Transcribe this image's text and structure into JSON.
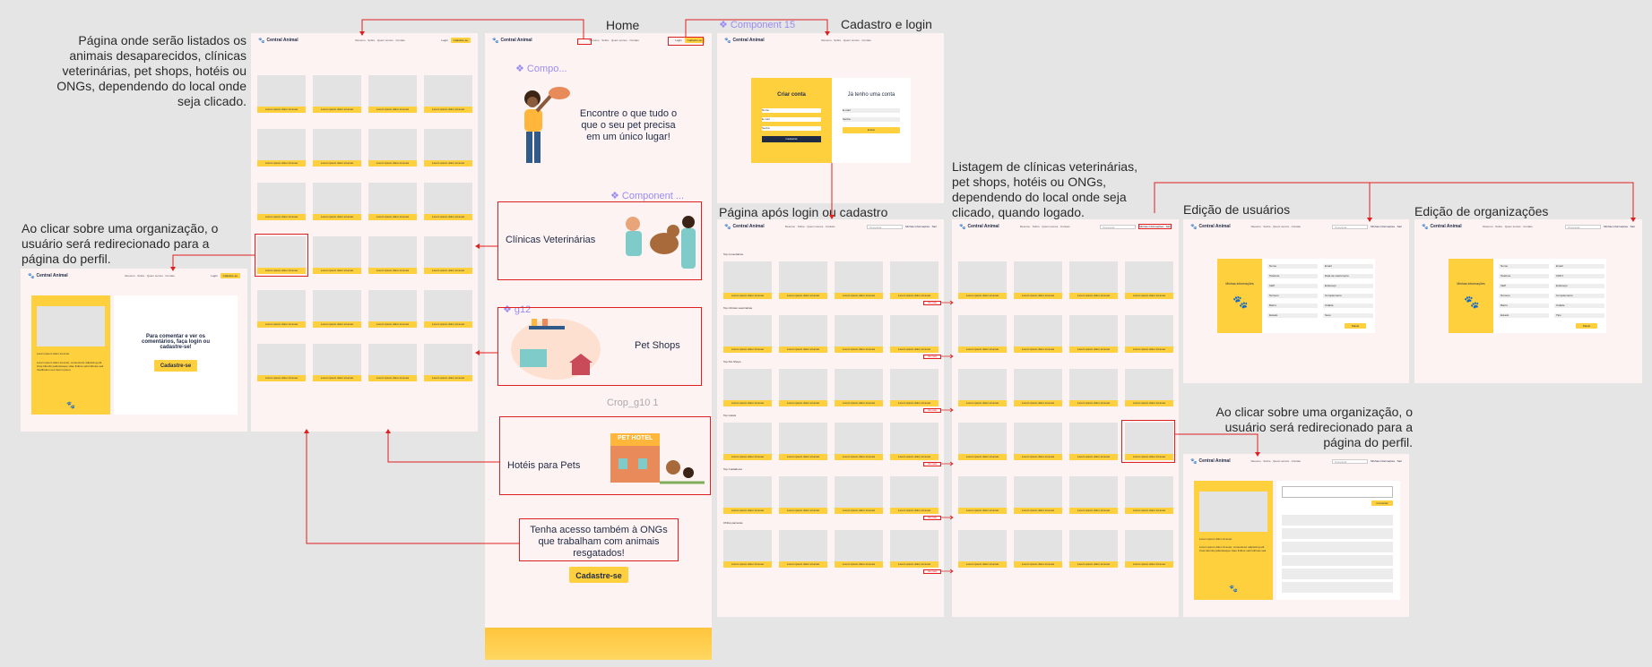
{
  "brand": "Central Animal",
  "card_label": "Lorem ipsum dolor sit amet",
  "nav": {
    "links": "Resumo · Sobre · Quem somos · Contato",
    "login": "Login",
    "signup": "Cadastre-se",
    "search_placeholder": "Pesquisar",
    "profile": "Minhas informações · Sair"
  },
  "annotations": {
    "top_left": "Página onde serão listados os animais desaparecidos, clínicas veterinárias, pet shops, hotéis ou ONGs, dependendo do local onde seja clicado.",
    "org_click_left": "Ao clicar sobre uma organização, o usuário será redirecionado para a página do perfil.",
    "listing_logged": "Listagem de clínicas veterinárias, pet shops, hotéis ou ONGs, dependendo do local onde seja clicado, quando logado.",
    "org_click_right": "Ao clicar sobre uma organização, o usuário será redirecionado para a página do perfil."
  },
  "frame_titles": {
    "home": "Home",
    "cadastro": "Cadastro e login",
    "after_login": "Página após login ou cadastro",
    "user_edit": "Edição de usuários",
    "org_edit": "Edição de organizações"
  },
  "components": {
    "component15": "❖ Component 15",
    "compo": "❖ Compo...",
    "component": "❖ Component ...",
    "g12": "❖ g12",
    "crop": "Crop_g10 1"
  },
  "home": {
    "hero_text": "Encontre o que tudo o que o seu pet precisa em um único lugar!",
    "sections": [
      "Clínicas Veterinárias",
      "Pet Shops",
      "Hotéis para Pets"
    ],
    "ongs_text": "Tenha acesso também à ONGs que trabalham com animais resgatados!",
    "cta": "Cadastre-se",
    "pet_hotel_sign": "PET HOTEL"
  },
  "cadastro": {
    "create_title": "Criar conta",
    "login_title": "Já tenho uma conta",
    "create_fields": [
      "Nome",
      "E-mail",
      "Senha"
    ],
    "create_button": "Cadastrar",
    "login_fields": [
      "E-mail",
      "Senha"
    ],
    "login_button": "Entrar"
  },
  "profile_public": {
    "cta_text": "Para comentar e ver os comentários, faça login ou cadastre-se!",
    "cta_button": "Cadastre-se",
    "org_name": "Lorem ipsum dolor sit amet",
    "org_desc": "Lorem ipsum dolor sit amet, consectetur adipiscing elit. Cras lobortis pellentesque vitae finibus velit ultricies sed. Vestibulum nec lorem ipsum."
  },
  "after_login": {
    "sections": [
      "Top comentários",
      "Top clínicas veterinárias",
      "Top Pet Shops",
      "Top Hotéis",
      "Top Cuidadores",
      "ONGs parceiras"
    ],
    "see_more": "Ver mais"
  },
  "user_edit": {
    "title": "Minhas informações",
    "fields": [
      "Nome",
      "Email",
      "Telefone",
      "Data de nascimento",
      "CEP",
      "Endereço",
      "Número",
      "Complemento",
      "Bairro",
      "Cidade",
      "Estado",
      "Sexo"
    ],
    "save": "Salvar"
  },
  "org_edit": {
    "title": "Minhas informações",
    "fields": [
      "Nome",
      "Email",
      "Telefone",
      "CNPJ",
      "CEP",
      "Endereço",
      "Número",
      "Complemento",
      "Bairro",
      "Cidade",
      "Estado",
      "Tipo"
    ],
    "save": "Salvar"
  },
  "profile_logged": {
    "org_name": "Lorem ipsum dolor sit amet",
    "org_desc": "Lorem ipsum dolor sit amet, consectetur adipiscing elit. Cras lobortis pellentesque vitae finibus velit ultricies sed.",
    "comment_button": "Comentar"
  }
}
